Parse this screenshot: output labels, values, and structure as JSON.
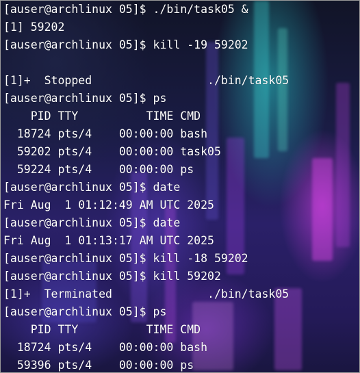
{
  "colors": {
    "text": "#ffffff",
    "background_base": "#1a1c45",
    "accent_teal": "#28c8c8",
    "accent_magenta": "#c83cdc",
    "accent_violet": "#7832c8"
  },
  "terminal": {
    "lines": [
      "[auser@archlinux 05]$ ./bin/task05 &",
      "[1] 59202",
      "[auser@archlinux 05]$ kill -19 59202",
      "",
      "[1]+  Stopped                 ./bin/task05",
      "[auser@archlinux 05]$ ps",
      "    PID TTY          TIME CMD",
      "  18724 pts/4    00:00:00 bash",
      "  59202 pts/4    00:00:00 task05",
      "  59224 pts/4    00:00:00 ps",
      "[auser@archlinux 05]$ date",
      "Fri Aug  1 01:12:49 AM UTC 2025",
      "[auser@archlinux 05]$ date",
      "Fri Aug  1 01:13:17 AM UTC 2025",
      "[auser@archlinux 05]$ kill -18 59202",
      "[auser@archlinux 05]$ kill 59202",
      "[1]+  Terminated              ./bin/task05",
      "[auser@archlinux 05]$ ps",
      "    PID TTY          TIME CMD",
      "  18724 pts/4    00:00:00 bash",
      "  59396 pts/4    00:00:00 ps"
    ]
  }
}
